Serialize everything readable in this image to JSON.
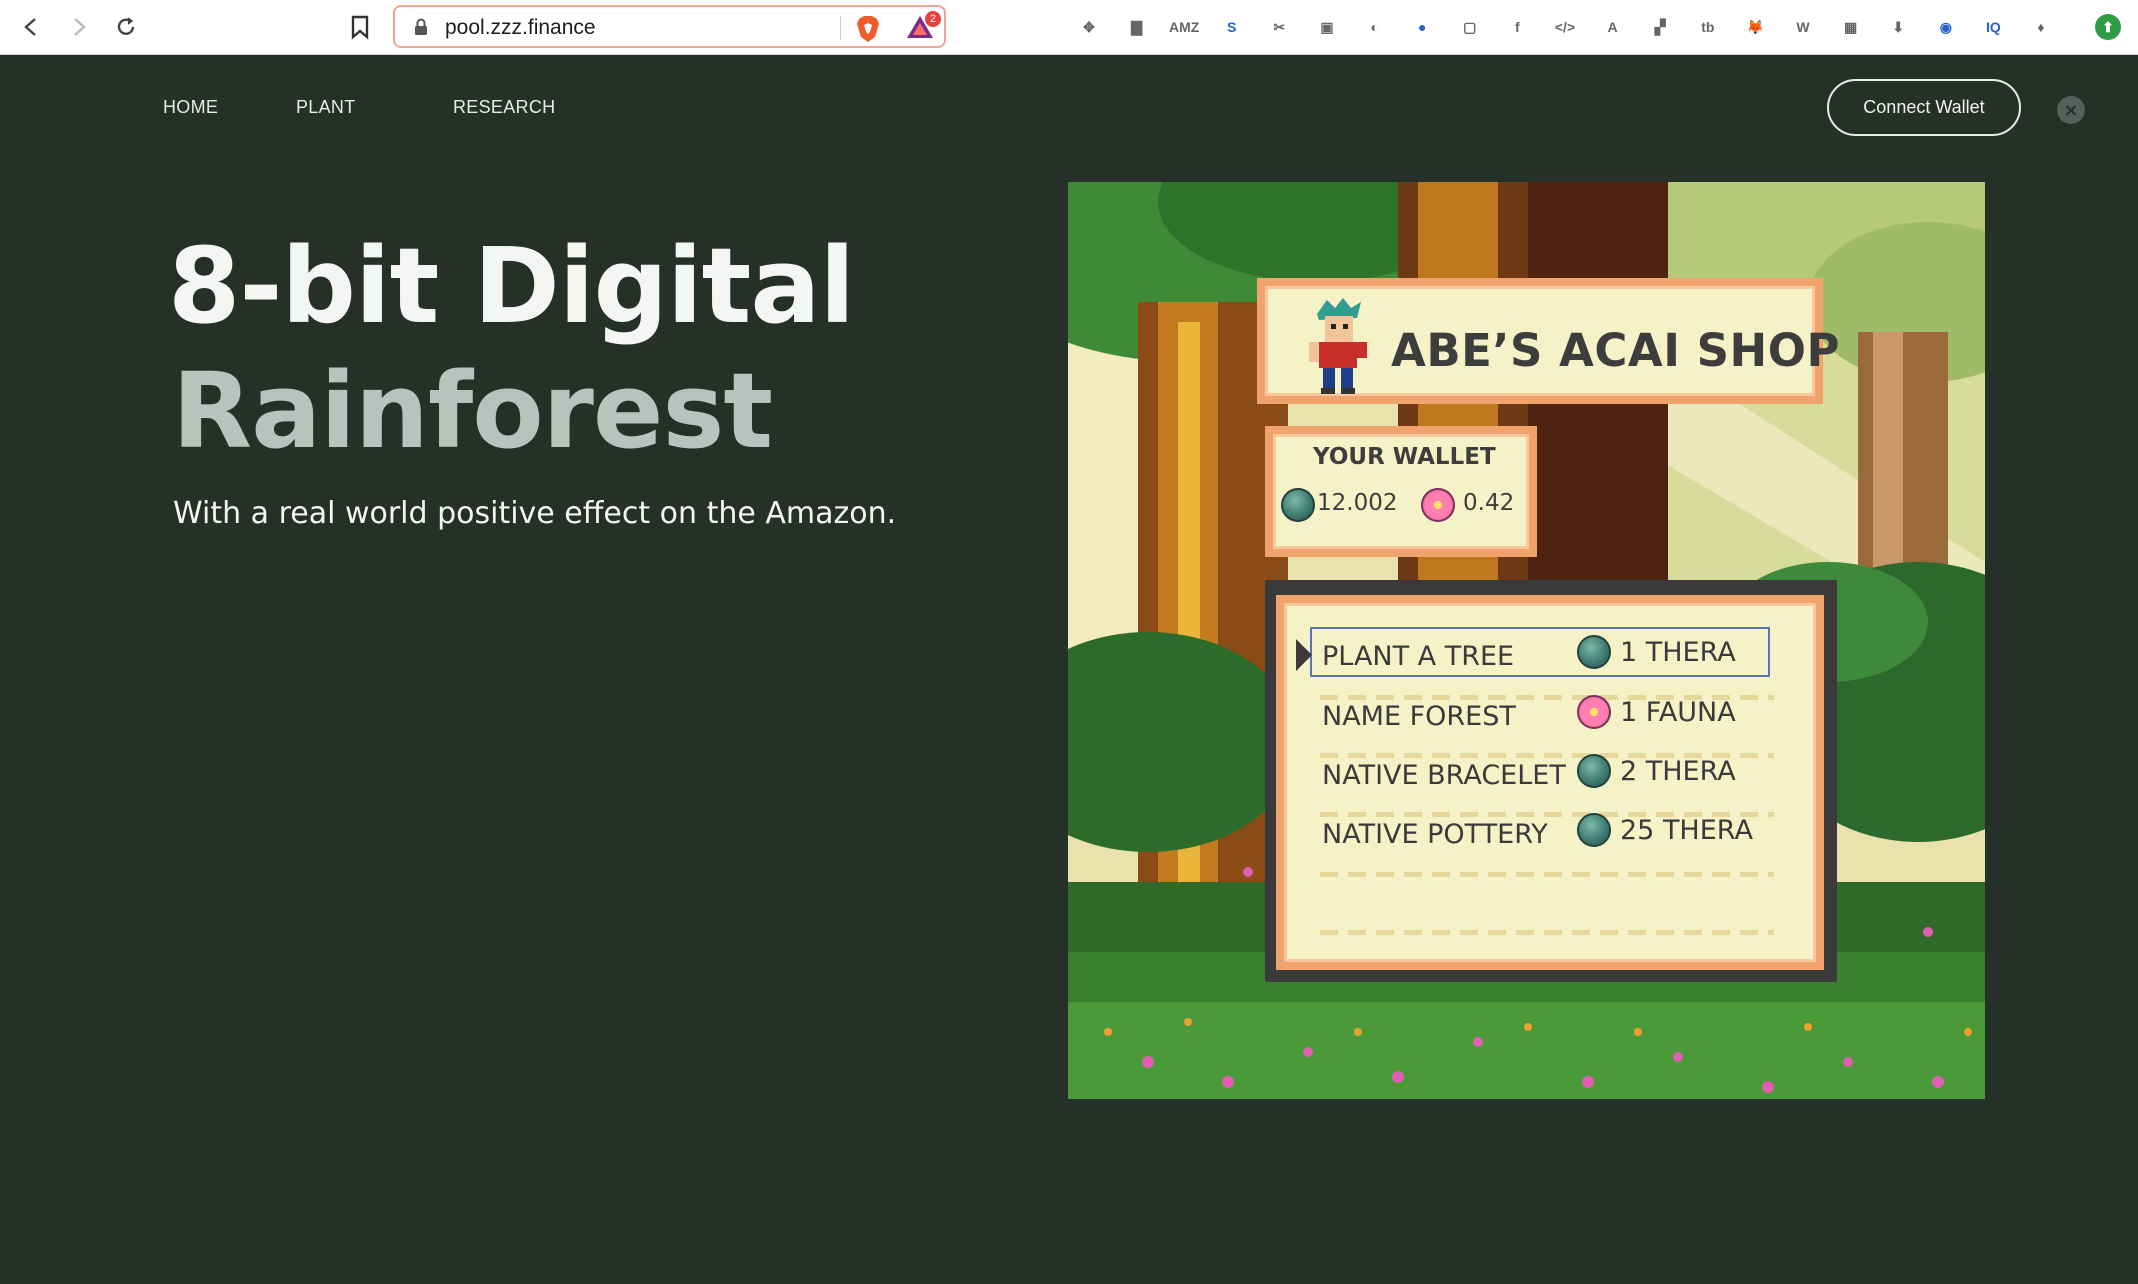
{
  "browser": {
    "url": "pool.zzz.finance",
    "rewards_badge": "2",
    "extension_badge": "0",
    "extensions": [
      {
        "name": "move-icon",
        "glyph": "✥"
      },
      {
        "name": "bar-chart-icon",
        "glyph": "▇"
      },
      {
        "name": "amazon-icon",
        "glyph": "AMZ"
      },
      {
        "name": "s-extension-icon",
        "glyph": "S"
      },
      {
        "name": "scissors-icon",
        "glyph": "✂"
      },
      {
        "name": "map-icon",
        "glyph": "▣"
      },
      {
        "name": "drop-icon",
        "glyph": "◐"
      },
      {
        "name": "blue-circle-icon",
        "glyph": "●"
      },
      {
        "name": "screen-icon",
        "glyph": "▢"
      },
      {
        "name": "facebook-icon",
        "glyph": "f"
      },
      {
        "name": "code-icon",
        "glyph": "</>"
      },
      {
        "name": "translate-icon",
        "glyph": "A"
      },
      {
        "name": "puzzle-icon",
        "glyph": "▞"
      },
      {
        "name": "tb-icon",
        "glyph": "tb"
      },
      {
        "name": "metamask-fox-icon",
        "glyph": "🦊"
      },
      {
        "name": "wikipedia-icon",
        "glyph": "W"
      },
      {
        "name": "grid-icon",
        "glyph": "▦"
      },
      {
        "name": "download-icon",
        "glyph": "⬇"
      },
      {
        "name": "opensea-icon",
        "glyph": "◉"
      },
      {
        "name": "iq-icon",
        "glyph": "IQ"
      },
      {
        "name": "ethereum-icon",
        "glyph": "♦"
      },
      {
        "name": "update-icon",
        "glyph": "⬆"
      }
    ]
  },
  "nav": {
    "home": "HOME",
    "plant": "PLANT",
    "research": "RESEARCH",
    "connect_wallet": "Connect Wallet",
    "close": "×"
  },
  "hero": {
    "line1": "8-bit Digital",
    "line2": "Rainforest",
    "subtitle": "With a real world positive effect on the Amazon."
  },
  "shop": {
    "title": "ABE’S ACAI SHOP",
    "wallet_label": "YOUR WALLET",
    "thera_balance": "12.002",
    "fauna_balance": "0.42",
    "items": [
      {
        "name": "PLANT A TREE",
        "price": "1 THERA",
        "coin": "thera"
      },
      {
        "name": "NAME FOREST",
        "price": "1 FAUNA",
        "coin": "fauna"
      },
      {
        "name": "NATIVE BRACELET",
        "price": "2 THERA",
        "coin": "thera"
      },
      {
        "name": "NATIVE POTTERY",
        "price": "25 THERA",
        "coin": "thera"
      }
    ]
  },
  "colors": {
    "page_bg": "#253029",
    "panel_bg": "#f6f2c7",
    "panel_border": "#f0a36c",
    "selector": "#5a72b8"
  }
}
